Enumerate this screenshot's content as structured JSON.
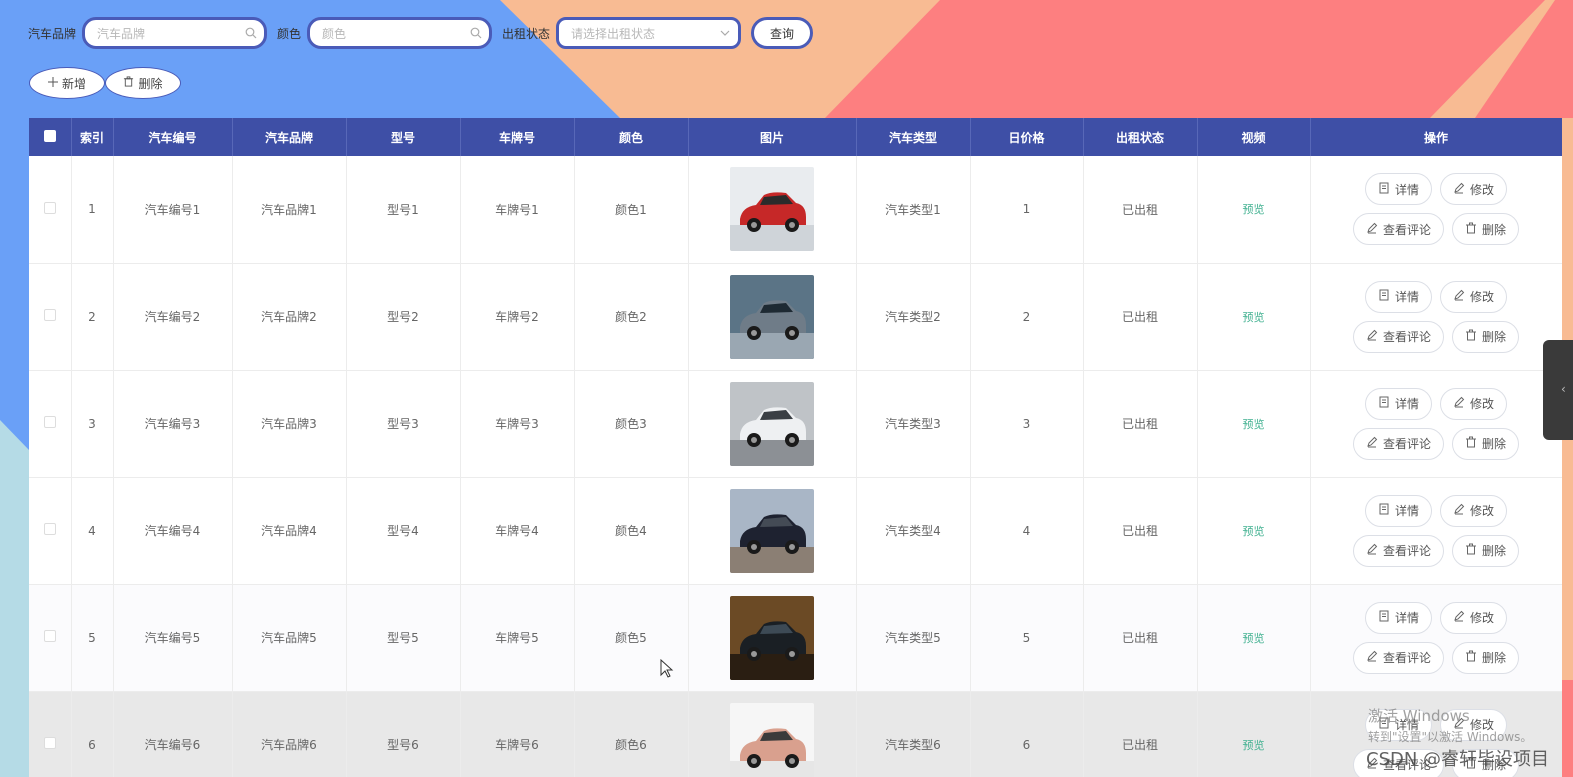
{
  "filters": {
    "brand_label": "汽车品牌",
    "brand_placeholder": "汽车品牌",
    "color_label": "颜色",
    "color_placeholder": "颜色",
    "status_label": "出租状态",
    "status_placeholder": "请选择出租状态",
    "query_button": "查询"
  },
  "actions": {
    "add_button": "新增",
    "delete_button": "删除"
  },
  "table": {
    "headers": [
      "索引",
      "汽车编号",
      "汽车品牌",
      "型号",
      "车牌号",
      "颜色",
      "图片",
      "汽车类型",
      "日价格",
      "出租状态",
      "视频",
      "操作"
    ],
    "rows": [
      {
        "index": "1",
        "code": "汽车编号1",
        "brand": "汽车品牌1",
        "model": "型号1",
        "plate": "车牌号1",
        "color": "颜色1",
        "image": "red-suv",
        "type": "汽车类型1",
        "price": "1",
        "status": "已出租",
        "video": "预览"
      },
      {
        "index": "2",
        "code": "汽车编号2",
        "brand": "汽车品牌2",
        "model": "型号2",
        "plate": "车牌号2",
        "color": "颜色2",
        "image": "gray-sedan",
        "type": "汽车类型2",
        "price": "2",
        "status": "已出租",
        "video": "预览"
      },
      {
        "index": "3",
        "code": "汽车编号3",
        "brand": "汽车品牌3",
        "model": "型号3",
        "plate": "车牌号3",
        "color": "颜色3",
        "image": "white-mpv",
        "type": "汽车类型3",
        "price": "3",
        "status": "已出租",
        "video": "预览"
      },
      {
        "index": "4",
        "code": "汽车编号4",
        "brand": "汽车品牌4",
        "model": "型号4",
        "plate": "车牌号4",
        "color": "颜色4",
        "image": "black-muscle-car",
        "type": "汽车类型4",
        "price": "4",
        "status": "已出租",
        "video": "预览"
      },
      {
        "index": "5",
        "code": "汽车编号5",
        "brand": "汽车品牌5",
        "model": "型号5",
        "plate": "车牌号5",
        "color": "颜色5",
        "image": "dark-sports-car",
        "type": "汽车类型5",
        "price": "5",
        "status": "已出租",
        "video": "预览"
      },
      {
        "index": "6",
        "code": "汽车编号6",
        "brand": "汽车品牌6",
        "model": "型号6",
        "plate": "车牌号6",
        "color": "颜色6",
        "image": "pink-sports-car",
        "type": "汽车类型6",
        "price": "6",
        "status": "已出租",
        "video": "预览"
      }
    ],
    "op_labels": {
      "detail": "详情",
      "edit": "修改",
      "comments": "查看评论",
      "delete": "删除"
    }
  },
  "watermark": {
    "line1": "激活 Windows",
    "line2": "转到\"设置\"以激活 Windows。",
    "line3": "CSDN @睿轩毕设项目"
  },
  "colors": {
    "header_bg": "#3e4fa6",
    "input_border": "#4a5bb8",
    "preview_link": "#3fb08f",
    "bg_blue": "#6aa0f7",
    "bg_peach": "#f8bb93",
    "bg_coral": "#fd7f80"
  }
}
